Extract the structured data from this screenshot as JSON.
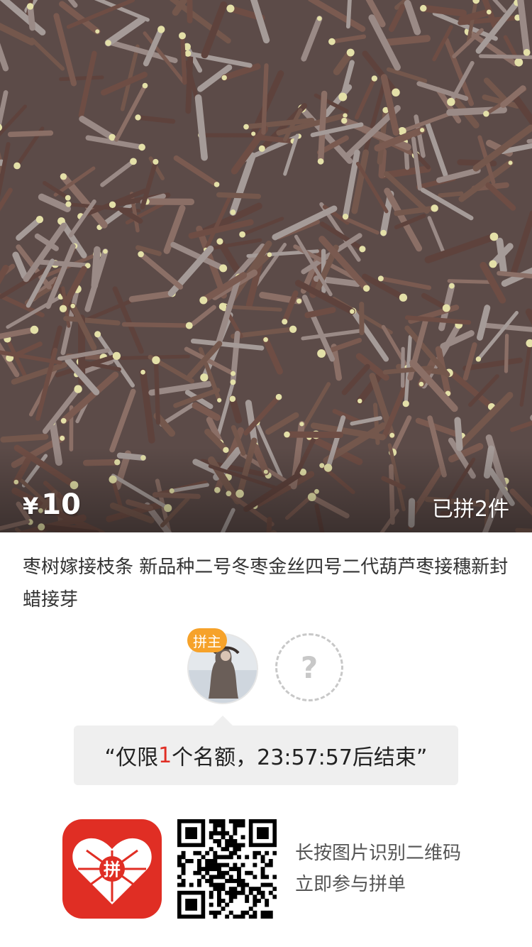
{
  "product": {
    "currency": "¥",
    "price": "10",
    "sold": "已拼2件",
    "title": "枣树嫁接枝条 新品种二号冬枣金丝四号二代葫芦枣接穗新封蜡接芽"
  },
  "group": {
    "leader_badge": "拼主",
    "empty_slot": "?",
    "notice_open": "“仅限",
    "notice_count": "1",
    "notice_rest": "个名额，23:57:57后结束”"
  },
  "footer": {
    "logo_text": "拼",
    "hint_line1": "长按图片识别二维码",
    "hint_line2": "立即参与拼单"
  },
  "colors": {
    "accent": "#e02e24",
    "badge": "#f6a22a"
  }
}
